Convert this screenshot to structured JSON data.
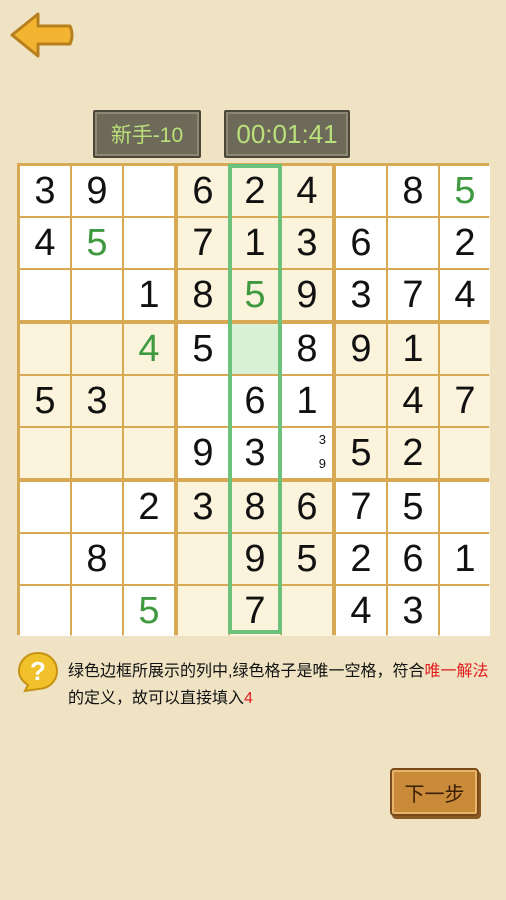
{
  "header": {
    "back_icon": "back-arrow-icon",
    "level": "新手-10",
    "timer": "00:01:41"
  },
  "board": {
    "rows": [
      [
        "3",
        "9",
        "",
        "6",
        "2",
        "4",
        "",
        "8",
        "5"
      ],
      [
        "4",
        "5",
        "",
        "7",
        "1",
        "3",
        "6",
        "",
        "2"
      ],
      [
        "",
        "",
        "1",
        "8",
        "5",
        "9",
        "3",
        "7",
        "4"
      ],
      [
        "",
        "",
        "4",
        "5",
        "",
        "8",
        "9",
        "1",
        ""
      ],
      [
        "5",
        "3",
        "",
        "",
        "6",
        "1",
        "",
        "4",
        "7"
      ],
      [
        "",
        "",
        "",
        "9",
        "3",
        "",
        "5",
        "2",
        ""
      ],
      [
        "",
        "",
        "2",
        "3",
        "8",
        "6",
        "7",
        "5",
        ""
      ],
      [
        "",
        "8",
        "",
        "",
        "9",
        "5",
        "2",
        "6",
        "1"
      ],
      [
        "",
        "",
        "5",
        "",
        "7",
        "",
        "4",
        "3",
        ""
      ]
    ],
    "green_cells": [
      [
        0,
        8
      ],
      [
        1,
        1
      ],
      [
        2,
        4
      ],
      [
        3,
        2
      ],
      [
        8,
        2
      ]
    ],
    "highlight_column": 4,
    "target_cell": [
      3,
      4
    ],
    "notes": {
      "cell": [
        5,
        5
      ],
      "values": [
        "3",
        "9"
      ]
    }
  },
  "hint": {
    "icon": "question-bubble-icon",
    "part1": "绿色边框所展示的列中,绿色格子是唯一空格，符合",
    "red1": "唯一解法",
    "part2": "的定义，故可以直接填入",
    "red2": "4"
  },
  "next_button": "下一步",
  "colors": {
    "green_digit": "#3f9a3f",
    "highlight": "#6cc27a",
    "target_bg": "#d9f2d6",
    "hint_red": "#e21b1b"
  }
}
